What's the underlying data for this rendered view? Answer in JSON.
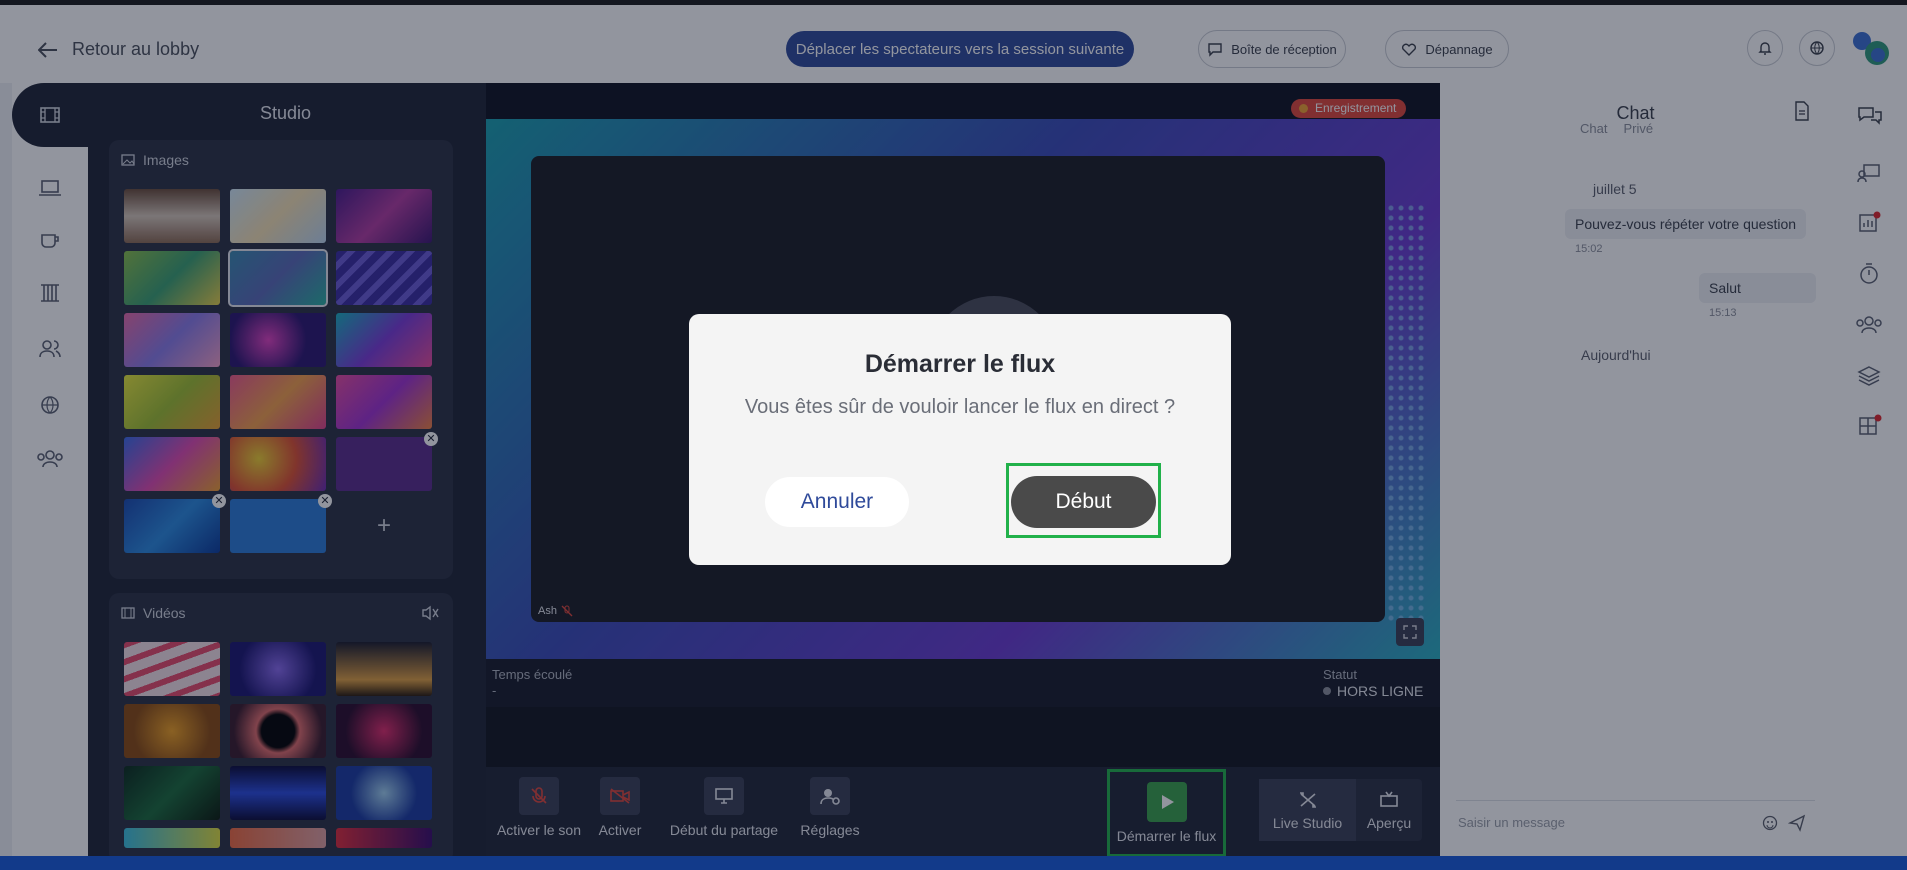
{
  "header": {
    "back_label": "Retour au lobby",
    "move_spectators": "Déplacer les spectateurs vers la session suivante",
    "inbox": "Boîte de réception",
    "troubleshoot": "Dépannage"
  },
  "studio": {
    "title": "Studio",
    "images_label": "Images",
    "videos_label": "Vidéos",
    "add_symbol": "+"
  },
  "stage": {
    "recording": "Enregistrement",
    "participant_name": "Ash",
    "elapsed_label": "Temps écoulé",
    "elapsed_value": "-",
    "status_label": "Statut",
    "status_value": "HORS LIGNE"
  },
  "controls": {
    "unmute": "Activer le son",
    "enable_video": "Activer",
    "share": "Début du partage",
    "settings": "Réglages",
    "start_stream": "Démarrer le flux",
    "live_studio": "Live Studio",
    "preview": "Aperçu"
  },
  "chat": {
    "title": "Chat",
    "tab_chat": "Chat",
    "tab_private": "Privé",
    "date1": "juillet 5",
    "messages": [
      {
        "text": "Pouvez-vous répéter votre question",
        "time": "15:02"
      },
      {
        "text": "Salut",
        "time": "15:13"
      }
    ],
    "date2": "Aujourd'hui",
    "input_placeholder": "Saisir un message"
  },
  "modal": {
    "title": "Démarrer le flux",
    "message": "Vous êtes sûr de vouloir lancer le flux en direct ?",
    "cancel": "Annuler",
    "confirm": "Début"
  },
  "colors": {
    "primary": "#2f4a9a",
    "highlight": "#21b14a",
    "dark_panel": "#1e2334",
    "recording": "#e0453a"
  }
}
